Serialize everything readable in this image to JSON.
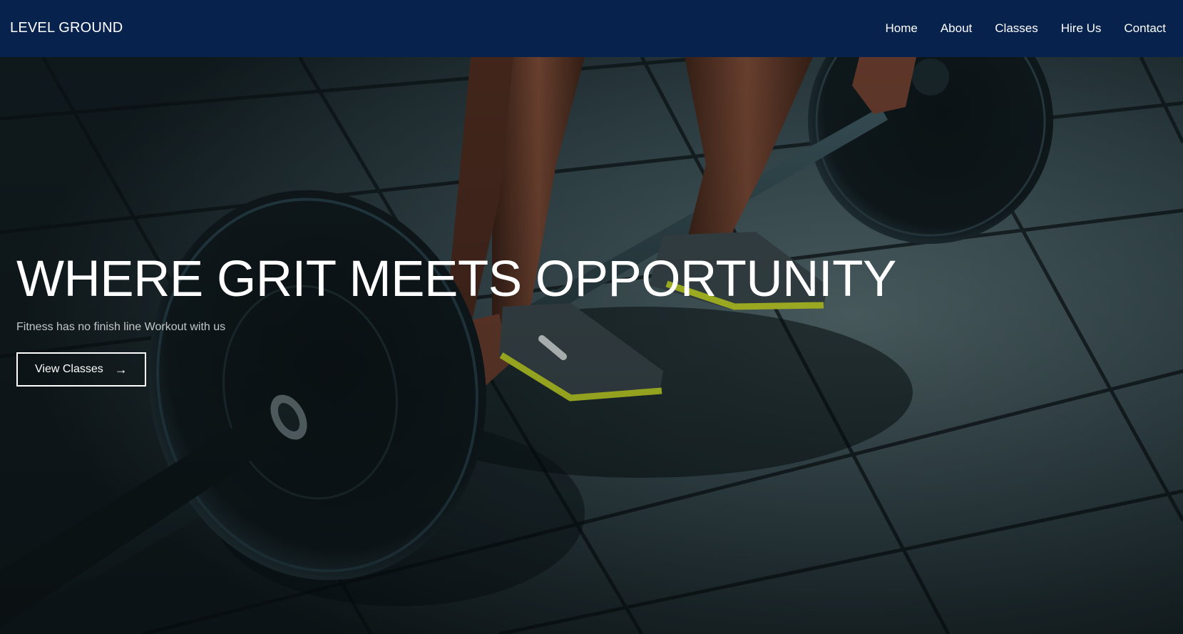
{
  "nav": {
    "brand": "LEVEL GROUND",
    "links": [
      "Home",
      "About",
      "Classes",
      "Hire Us",
      "Contact"
    ]
  },
  "hero": {
    "title": "WHERE GRIT MEETS OPPORTUNITY",
    "subtitle": "Fitness has no finish line Workout with us",
    "cta_label": "View Classes",
    "cta_icon": "arrow-right-icon",
    "background_image": "gym-floor-barbell-deadlift-photo"
  },
  "colors": {
    "navbar_bg": "#08224e",
    "text": "#ffffff",
    "subtitle": "#c2c8ca",
    "shoe_accent": "#c8dc2a"
  }
}
